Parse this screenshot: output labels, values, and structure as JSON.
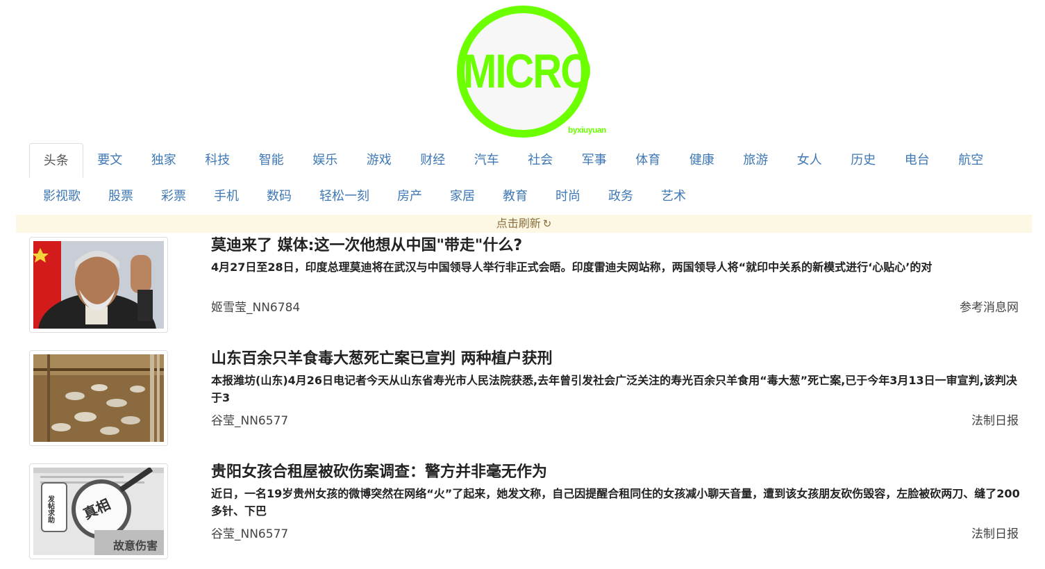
{
  "logo": {
    "text": "MICRO",
    "sub": "byxiuyuan",
    "color": "#6cff00"
  },
  "nav": {
    "row1": [
      "头条",
      "要文",
      "独家",
      "科技",
      "智能",
      "娱乐",
      "游戏",
      "财经",
      "汽车",
      "社会",
      "军事",
      "体育",
      "健康",
      "旅游",
      "女人",
      "历史",
      "电台",
      "航空"
    ],
    "row2": [
      "影视歌",
      "股票",
      "彩票",
      "手机",
      "数码",
      "轻松一刻",
      "房产",
      "家居",
      "教育",
      "时尚",
      "政务",
      "艺术"
    ],
    "active": "头条"
  },
  "refresh": {
    "label": "点击刷新",
    "icon": "refresh-icon"
  },
  "news": [
    {
      "title": "莫迪来了 媒体:这一次他想从中国\"带走\"什么?",
      "summary": "4月27日至28日，印度总理莫迪将在武汉与中国领导人举行非正式会晤。印度雷迪夫网站称，两国领导人将“就印中关系的新模式进行‘心贴心’的对",
      "author": "姬雪莹_NN6784",
      "source": "参考消息网"
    },
    {
      "title": "山东百余只羊食毒大葱死亡案已宣判 两种植户获刑",
      "summary": "本报潍坊(山东)4月26日电记者今天从山东省寿光市人民法院获悉,去年曾引发社会广泛关注的寿光百余只羊食用“毒大葱”死亡案,已于今年3月13日一审宣判,该判决于3",
      "author": "谷莹_NN6577",
      "source": "法制日报"
    },
    {
      "title": "贵阳女孩合租屋被砍伤案调查：警方并非毫无作为",
      "summary": "近日，一名19岁贵州女孩的微博突然在网络“火”了起来，她发文称，自己因提醒合租同住的女孩减小聊天音量，遭到该女孩朋友砍伤毁容，左脸被砍两刀、缝了200多针、下巴",
      "author": "谷莹_NN6577",
      "source": "法制日报",
      "image_text": {
        "sign": "发帖求助",
        "lens": "真相",
        "bottom": "故意伤害"
      }
    }
  ]
}
